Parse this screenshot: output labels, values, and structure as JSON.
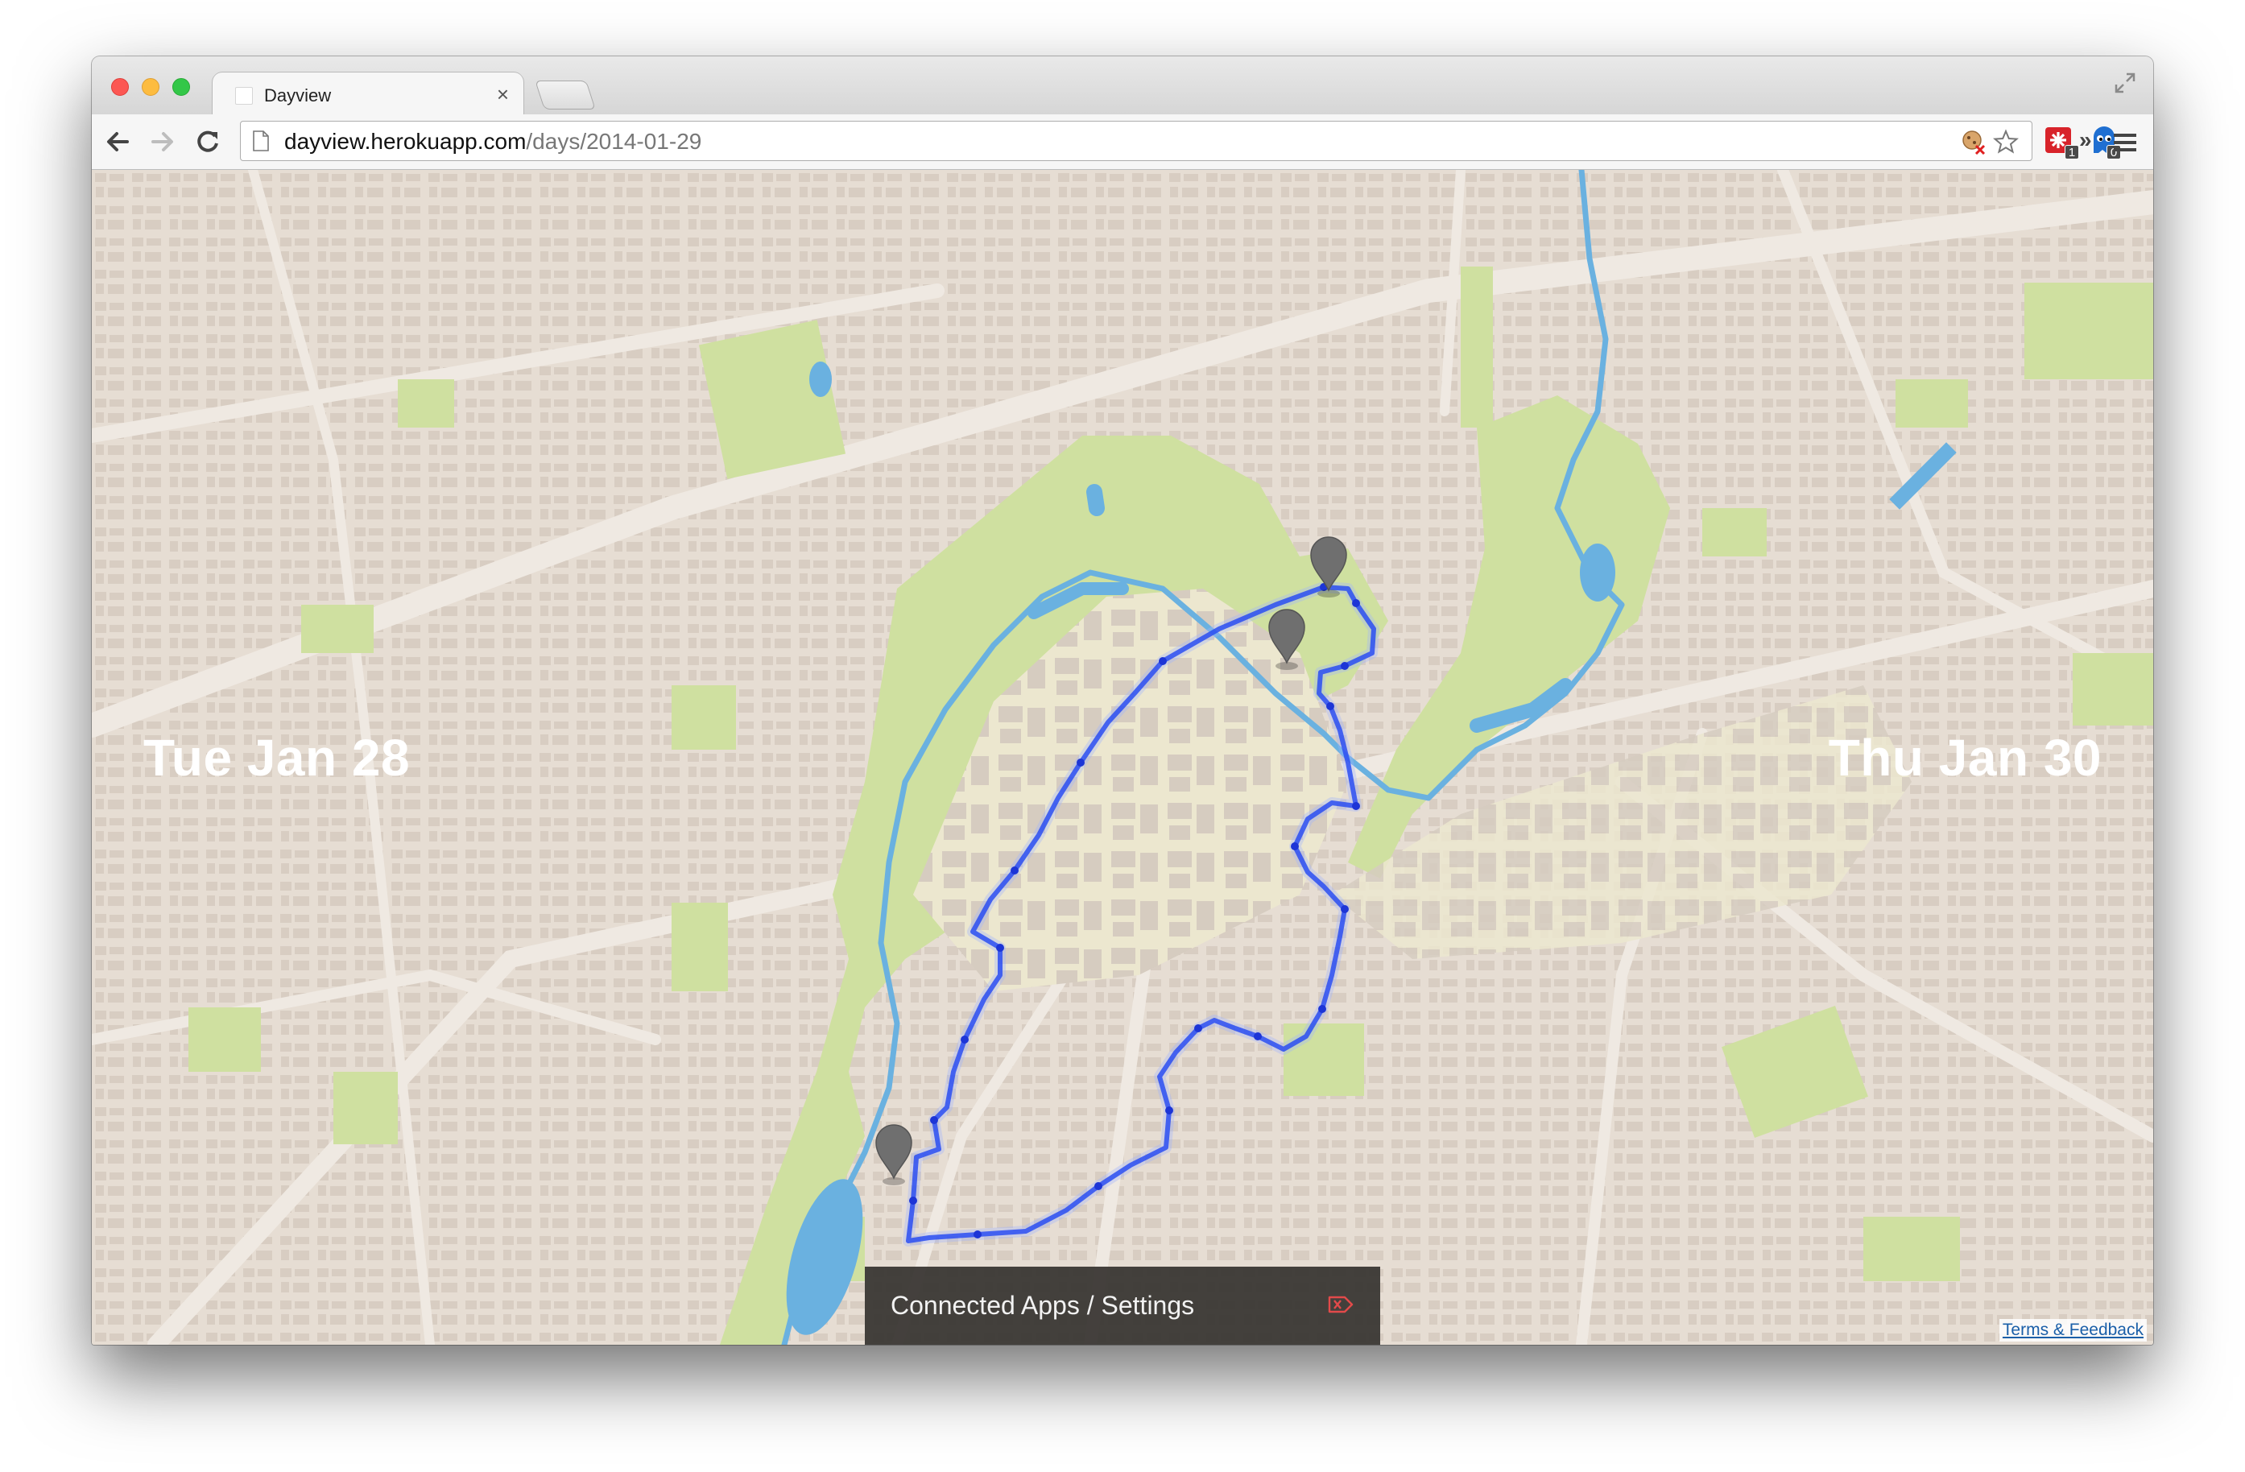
{
  "browser": {
    "tab_title": "Dayview",
    "tab_close_glyph": "×",
    "url_host": "dayview.herokuapp.com",
    "url_path": "/days/2014-01-29",
    "extensions": [
      {
        "icon": "puzzle-red-icon",
        "badge": "1"
      },
      {
        "icon": "ghost-icon",
        "badge": "0"
      }
    ],
    "overflow_glyph": "»"
  },
  "page": {
    "prev_day": "Tue Jan 28",
    "next_day": "Thu Jan 30",
    "settings_label": "Connected Apps / Settings",
    "settings_icon": "tag-x-icon",
    "terms_link": "Terms & Feedback"
  },
  "colors": {
    "route": "#2a4df2",
    "marker": "#6f6f6f",
    "park": "#cfe0a0",
    "water": "#6ab1e0",
    "land": "#e8dfd6",
    "building": "#d3c8bd"
  }
}
